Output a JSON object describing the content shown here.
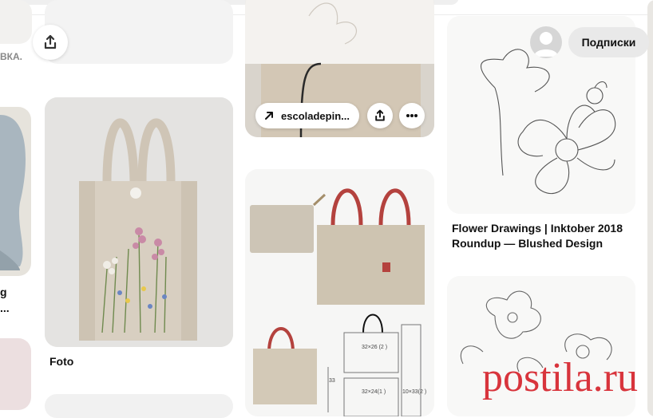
{
  "header": {
    "subscribe_label": "Подписки"
  },
  "pins": {
    "left_partial_top_text": "ВКА.",
    "left_partial_caption": "g\n...",
    "foto_caption": "Foto",
    "escola_link": "escoladepin...",
    "flower_caption": "Flower Drawings | Inktober 2018 Roundup — Blushed Design",
    "pattern_labels": [
      "32×26 (2 )",
      "32×24(1 )",
      "10×33(2 )",
      "33"
    ]
  },
  "watermark": "postila.ru",
  "icons": {
    "share": "share-upload-icon",
    "link": "arrow-up-right-icon",
    "more": "more-dots-icon",
    "user": "user-avatar-icon"
  },
  "colors": {
    "accent_watermark": "#d8343c",
    "subscribe_bg": "#e9e9e9",
    "page_bg": "#ffffff"
  }
}
